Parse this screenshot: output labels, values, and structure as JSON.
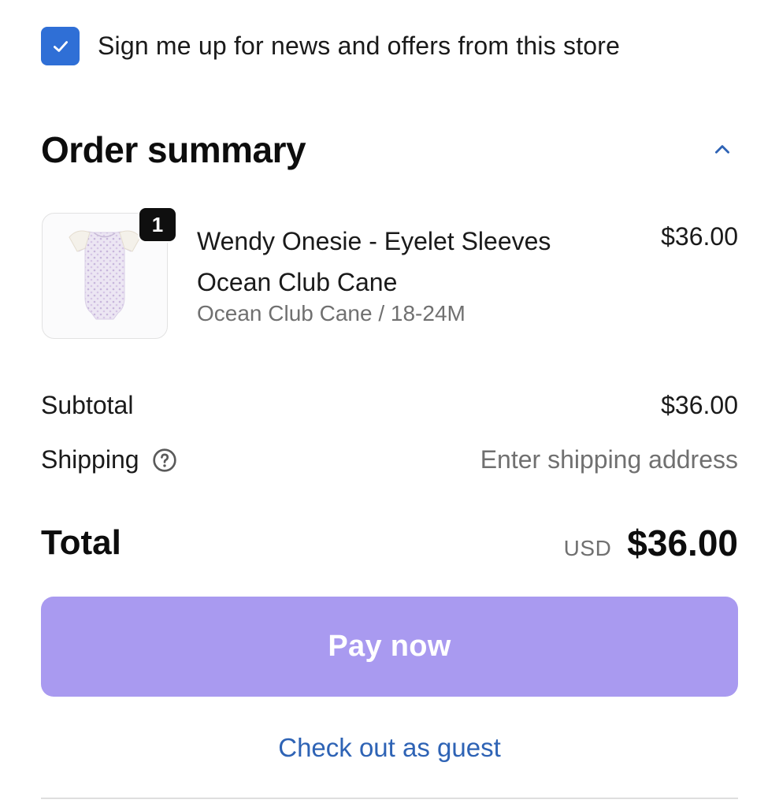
{
  "newsletter": {
    "checked": true,
    "label": "Sign me up for news and offers from this store"
  },
  "order_summary": {
    "title": "Order summary",
    "toggle_icon": "chevron-up-icon"
  },
  "line_item": {
    "quantity": "1",
    "name": "Wendy Onesie - Eyelet Sleeves Ocean Club Cane",
    "variant": "Ocean Club Cane / 18-24M",
    "price": "$36.00",
    "image_icon": "onesie-product-image"
  },
  "costs": {
    "subtotal_label": "Subtotal",
    "subtotal_value": "$36.00",
    "shipping_label": "Shipping",
    "shipping_value": "Enter shipping address",
    "shipping_help_icon": "help-circle-icon"
  },
  "total": {
    "label": "Total",
    "currency": "USD",
    "amount": "$36.00"
  },
  "actions": {
    "pay_label": "Pay now",
    "guest_label": "Check out as guest"
  },
  "colors": {
    "checkbox": "#2f6fd6",
    "pay_button": "#a99af0",
    "link": "#2e63b5",
    "muted_text": "#707070"
  }
}
